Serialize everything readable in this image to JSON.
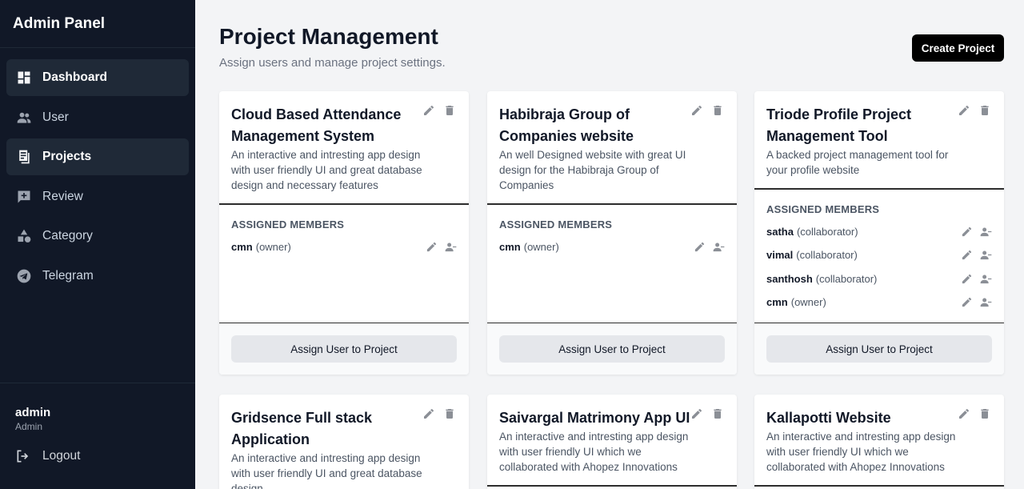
{
  "app": {
    "title": "Admin Panel"
  },
  "sidebar": {
    "items": [
      {
        "label": "Dashboard",
        "icon": "dashboard-icon",
        "active": true
      },
      {
        "label": "User",
        "icon": "users-icon",
        "active": false
      },
      {
        "label": "Projects",
        "icon": "projects-icon",
        "active": true
      },
      {
        "label": "Review",
        "icon": "review-icon",
        "active": false
      },
      {
        "label": "Category",
        "icon": "category-icon",
        "active": false
      },
      {
        "label": "Telegram",
        "icon": "telegram-icon",
        "active": false
      }
    ],
    "user": {
      "name": "admin",
      "role": "Admin"
    },
    "logout_label": "Logout"
  },
  "header": {
    "title": "Project Management",
    "subtitle": "Assign users and manage project settings.",
    "create_label": "Create Project"
  },
  "cards": [
    {
      "title": "Cloud Based Attendance Management System",
      "description": "An interactive and intresting app design with user friendly UI and great database design and necessary features",
      "members_label": "ASSIGNED MEMBERS",
      "members": [
        {
          "name": "cmn",
          "role": "(owner)"
        }
      ],
      "assign_label": "Assign User to Project"
    },
    {
      "title": "Habibraja Group of Companies website",
      "description": "An well Designed website with great UI design for the Habibraja Group of Companies",
      "members_label": "ASSIGNED MEMBERS",
      "members": [
        {
          "name": "cmn",
          "role": "(owner)"
        }
      ],
      "assign_label": "Assign User to Project"
    },
    {
      "title": "Triode Profile Project Management Tool",
      "description": "A backed project management tool for your profile website",
      "members_label": "ASSIGNED MEMBERS",
      "members": [
        {
          "name": "satha",
          "role": "(collaborator)"
        },
        {
          "name": "vimal",
          "role": "(collaborator)"
        },
        {
          "name": "santhosh",
          "role": "(collaborator)"
        },
        {
          "name": "cmn",
          "role": "(owner)"
        }
      ],
      "assign_label": "Assign User to Project"
    },
    {
      "title": "Gridsence Full stack Application",
      "description": "An interactive and intresting app design with user friendly UI and great database design"
    },
    {
      "title": "Saivargal Matrimony App UI",
      "description": "An interactive and intresting app design with user friendly UI which we collaborated with Ahopez Innovations"
    },
    {
      "title": "Kallapotti Website",
      "description": "An interactive and intresting app design with user friendly UI which we collaborated with Ahopez Innovations"
    }
  ]
}
